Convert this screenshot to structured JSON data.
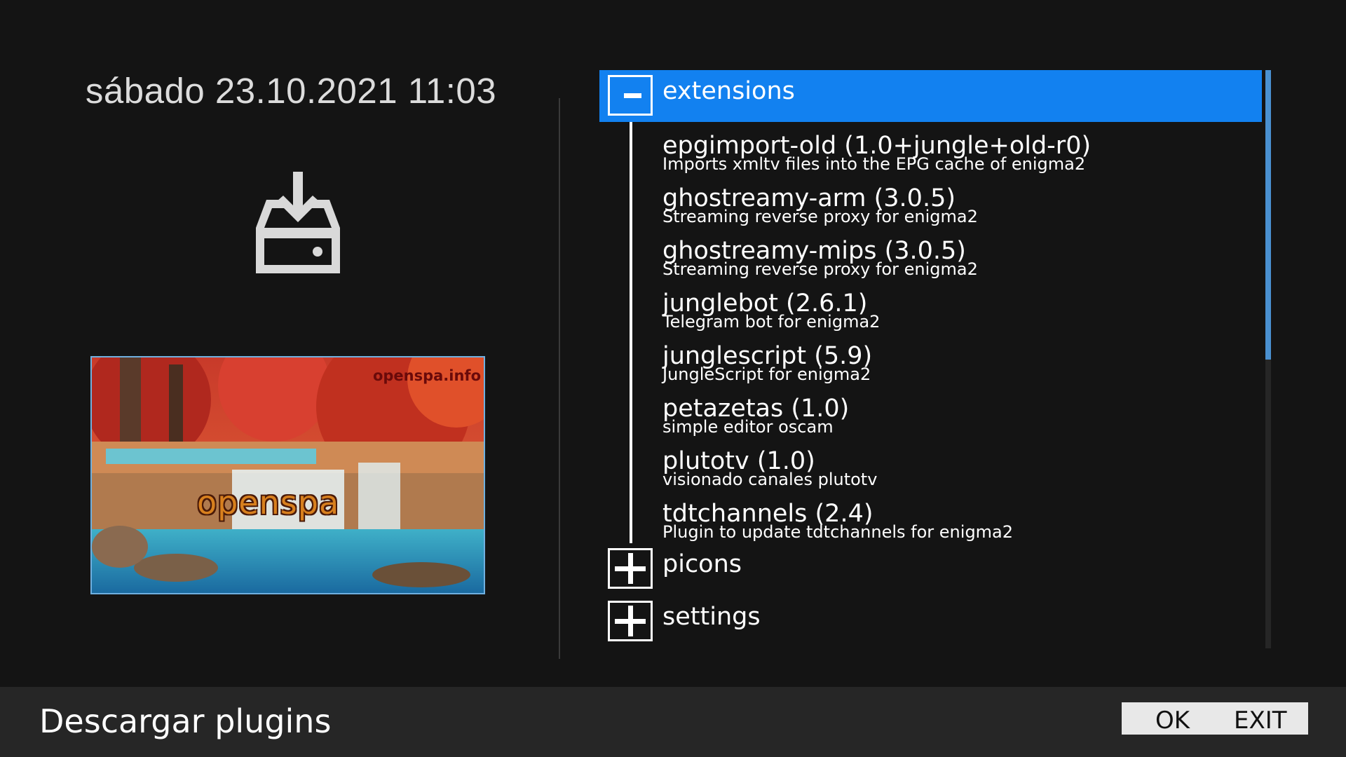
{
  "header": {
    "datetime": "sábado 23.10.2021 11:03"
  },
  "preview": {
    "watermark": "openspa.info",
    "logo_text": "openspa"
  },
  "tree": {
    "groups": [
      {
        "label": "extensions",
        "expanded": true,
        "selected": true,
        "toggle_icon": "minus-icon",
        "plugins": [
          {
            "name": "epgimport-old  (1.0+jungle+old-r0)",
            "description": "Imports xmltv files into the EPG cache of enigma2"
          },
          {
            "name": "ghostreamy-arm  (3.0.5)",
            "description": "Streaming reverse proxy for enigma2"
          },
          {
            "name": "ghostreamy-mips  (3.0.5)",
            "description": "Streaming reverse proxy for enigma2"
          },
          {
            "name": "junglebot  (2.6.1)",
            "description": "Telegram bot for enigma2"
          },
          {
            "name": "junglescript  (5.9)",
            "description": "JungleScript for enigma2"
          },
          {
            "name": "petazetas  (1.0)",
            "description": "simple editor oscam"
          },
          {
            "name": "plutotv  (1.0)",
            "description": "visionado canales plutotv"
          },
          {
            "name": "tdtchannels  (2.4)",
            "description": "Plugin to update tdtchannels for enigma2"
          }
        ]
      },
      {
        "label": "picons",
        "expanded": false,
        "selected": false,
        "toggle_icon": "plus-icon"
      },
      {
        "label": "settings",
        "expanded": false,
        "selected": false,
        "toggle_icon": "plus-icon"
      }
    ],
    "scroll_position_fraction": 0.0,
    "scroll_visible_fraction": 0.5
  },
  "footer": {
    "title": "Descargar plugins",
    "keys": {
      "ok": "OK",
      "exit": "EXIT"
    }
  },
  "colors": {
    "background": "#141414",
    "selection": "#1281f0",
    "footer_bg": "#262626",
    "scroll_thumb": "#4a90d0",
    "preview_border": "#6fb0e0"
  },
  "icons": {
    "download": "download-tray-icon"
  }
}
